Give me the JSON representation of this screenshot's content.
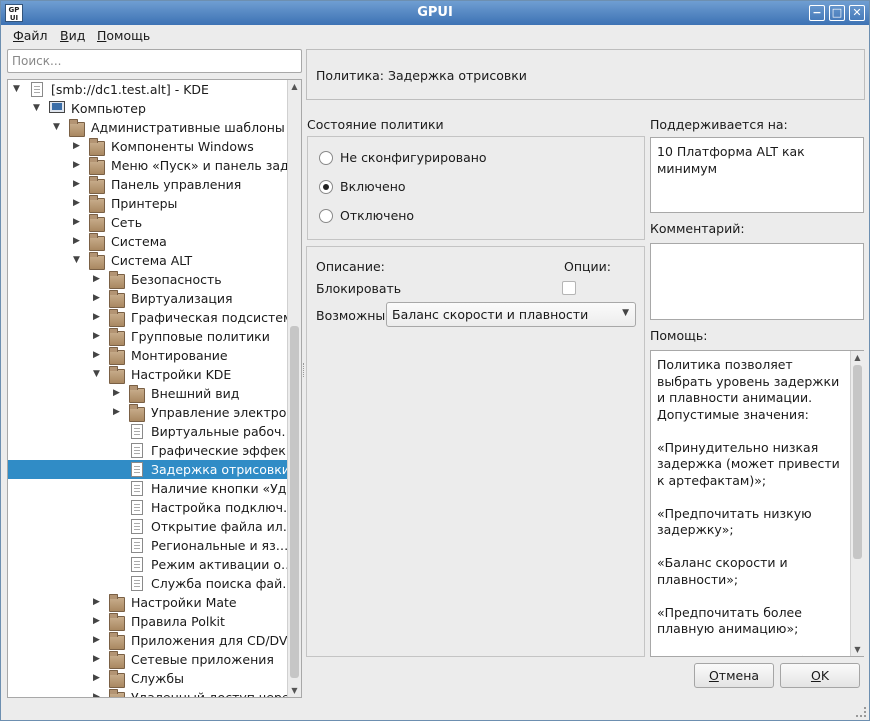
{
  "window": {
    "title": "GPUI",
    "app_icon_text": "GP\nUI"
  },
  "menu": [
    "Файл",
    "Вид",
    "Помощь"
  ],
  "search": {
    "placeholder": "Поиск..."
  },
  "tree": [
    {
      "label": "[smb://dc1.test.alt] - KDE",
      "level": 0,
      "icon": "document-icon",
      "arrow": "down"
    },
    {
      "label": "Компьютер",
      "level": 1,
      "icon": "computer-icon",
      "arrow": "down"
    },
    {
      "label": "Административные шаблоны",
      "level": 2,
      "icon": "folder-icon",
      "arrow": "down"
    },
    {
      "label": "Компоненты Windows",
      "level": 3,
      "icon": "folder-icon",
      "arrow": "right"
    },
    {
      "label": "Меню «Пуск» и панель зад…",
      "level": 3,
      "icon": "folder-icon",
      "arrow": "right"
    },
    {
      "label": "Панель управления",
      "level": 3,
      "icon": "folder-icon",
      "arrow": "right"
    },
    {
      "label": "Принтеры",
      "level": 3,
      "icon": "folder-icon",
      "arrow": "right"
    },
    {
      "label": "Сеть",
      "level": 3,
      "icon": "folder-icon",
      "arrow": "right"
    },
    {
      "label": "Система",
      "level": 3,
      "icon": "folder-icon",
      "arrow": "right"
    },
    {
      "label": "Система ALT",
      "level": 3,
      "icon": "folder-icon",
      "arrow": "down"
    },
    {
      "label": "Безопасность",
      "level": 4,
      "icon": "folder-icon",
      "arrow": "right"
    },
    {
      "label": "Виртуализация",
      "level": 4,
      "icon": "folder-icon",
      "arrow": "right"
    },
    {
      "label": "Графическая подсистема",
      "level": 4,
      "icon": "folder-icon",
      "arrow": "right"
    },
    {
      "label": "Групповые политики",
      "level": 4,
      "icon": "folder-icon",
      "arrow": "right"
    },
    {
      "label": "Монтирование",
      "level": 4,
      "icon": "folder-icon",
      "arrow": "right"
    },
    {
      "label": "Настройки KDE",
      "level": 4,
      "icon": "folder-icon",
      "arrow": "down"
    },
    {
      "label": "Внешний вид",
      "level": 5,
      "icon": "folder-icon",
      "arrow": "right"
    },
    {
      "label": "Управление электро…",
      "level": 5,
      "icon": "folder-icon",
      "arrow": "right"
    },
    {
      "label": "Виртуальные рабоч…",
      "level": 5,
      "icon": "document-icon",
      "arrow": ""
    },
    {
      "label": "Графические эффек…",
      "level": 5,
      "icon": "document-icon",
      "arrow": ""
    },
    {
      "label": "Задержка отрисовки",
      "level": 5,
      "icon": "document-icon",
      "arrow": "",
      "selected": true
    },
    {
      "label": "Наличие кнопки «Уд…",
      "level": 5,
      "icon": "document-icon",
      "arrow": ""
    },
    {
      "label": "Настройка подключ…",
      "level": 5,
      "icon": "document-icon",
      "arrow": ""
    },
    {
      "label": "Открытие файла ил…",
      "level": 5,
      "icon": "document-icon",
      "arrow": ""
    },
    {
      "label": "Региональные и яз…",
      "level": 5,
      "icon": "document-icon",
      "arrow": ""
    },
    {
      "label": "Режим активации о…",
      "level": 5,
      "icon": "document-icon",
      "arrow": ""
    },
    {
      "label": "Служба поиска фай…",
      "level": 5,
      "icon": "document-icon",
      "arrow": ""
    },
    {
      "label": "Настройки Mate",
      "level": 4,
      "icon": "folder-icon",
      "arrow": "right"
    },
    {
      "label": "Правила Polkit",
      "level": 4,
      "icon": "folder-icon",
      "arrow": "right"
    },
    {
      "label": "Приложения для CD/DVD",
      "level": 4,
      "icon": "folder-icon",
      "arrow": "right"
    },
    {
      "label": "Сетевые приложения",
      "level": 4,
      "icon": "folder-icon",
      "arrow": "right"
    },
    {
      "label": "Службы",
      "level": 4,
      "icon": "folder-icon",
      "arrow": "right"
    },
    {
      "label": "Удаленный доступ через…",
      "level": 4,
      "icon": "folder-icon",
      "arrow": "right"
    }
  ],
  "policy": {
    "header": "Политика: Задержка отрисовки",
    "state_label": "Состояние политики",
    "states": [
      {
        "label": "Не сконфигурировано",
        "checked": false
      },
      {
        "label": "Включено",
        "checked": true
      },
      {
        "label": "Отключено",
        "checked": false
      }
    ],
    "supported_label": "Поддерживается на:",
    "supported_value": "10 Платформа ALT как минимум",
    "comment_label": "Комментарий:",
    "comment_value": "",
    "description_label": "Описание:",
    "options_label": "Опции:",
    "block_label": "Блокировать",
    "block_checked": false,
    "possible_label": "Возможные",
    "possible_value": "Баланс скорости и плавности",
    "help_label": "Помощь:",
    "help_text": "Политика позволяет выбрать уровень задержки и плавности анимации. Допустимые значения:\n\n«Принудительно низкая задержка (может привести к артефактам)»;\n\n«Предпочитать низкую задержку»;\n\n«Баланс скорости и плавности»;\n\n«Предпочитать более плавную анимацию»;\n\n«Принудительно наиболее"
  },
  "buttons": {
    "cancel": "Отмена",
    "ok": "OK"
  }
}
